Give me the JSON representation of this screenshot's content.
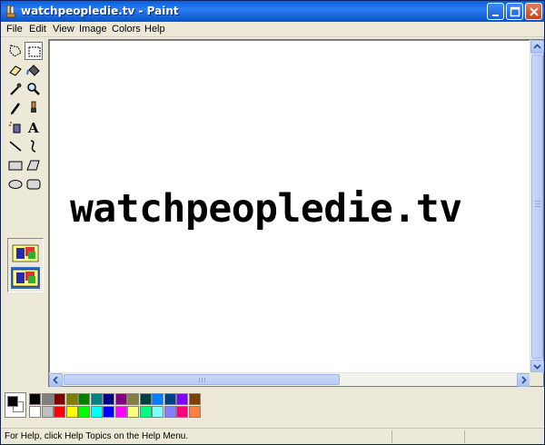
{
  "window": {
    "title": "watchpeopledie.tv - Paint",
    "controls": [
      "minimize-icon",
      "maximize-icon",
      "close-icon"
    ]
  },
  "menu": [
    "File",
    "Edit",
    "View",
    "Image",
    "Colors",
    "Help"
  ],
  "tools": [
    {
      "name": "free-form-select",
      "icon": "free-form-select-icon"
    },
    {
      "name": "select",
      "icon": "rectangle-select-icon",
      "selected": true
    },
    {
      "name": "eraser",
      "icon": "eraser-icon"
    },
    {
      "name": "fill-with-color",
      "icon": "paint-bucket-icon"
    },
    {
      "name": "pick-color",
      "icon": "eyedropper-icon"
    },
    {
      "name": "magnifier",
      "icon": "magnifier-icon"
    },
    {
      "name": "pencil",
      "icon": "pencil-icon"
    },
    {
      "name": "brush",
      "icon": "brush-icon"
    },
    {
      "name": "airbrush",
      "icon": "airbrush-icon"
    },
    {
      "name": "text",
      "icon": "text-icon"
    },
    {
      "name": "line",
      "icon": "line-icon"
    },
    {
      "name": "curve",
      "icon": "curve-icon"
    },
    {
      "name": "rectangle",
      "icon": "rectangle-icon"
    },
    {
      "name": "polygon",
      "icon": "polygon-icon"
    },
    {
      "name": "ellipse",
      "icon": "ellipse-icon"
    },
    {
      "name": "rounded-rectangle",
      "icon": "rounded-rectangle-icon"
    }
  ],
  "canvas": {
    "text": "watchpeopledie.tv",
    "text_label": "A"
  },
  "palette": {
    "foreground": "#000000",
    "background": "#ffffff",
    "top_row": [
      "#000000",
      "#808080",
      "#800000",
      "#808000",
      "#008000",
      "#008080",
      "#000080",
      "#800080",
      "#808040",
      "#004040",
      "#0080ff",
      "#004080",
      "#8000ff",
      "#804000"
    ],
    "bottom_row": [
      "#ffffff",
      "#c0c0c0",
      "#ff0000",
      "#ffff00",
      "#00ff00",
      "#00ffff",
      "#0000ff",
      "#ff00ff",
      "#ffff80",
      "#00ff80",
      "#80ffff",
      "#8080ff",
      "#ff0080",
      "#ff8040"
    ]
  },
  "status": {
    "help_text": "For Help, click Help Topics on the Help Menu."
  }
}
